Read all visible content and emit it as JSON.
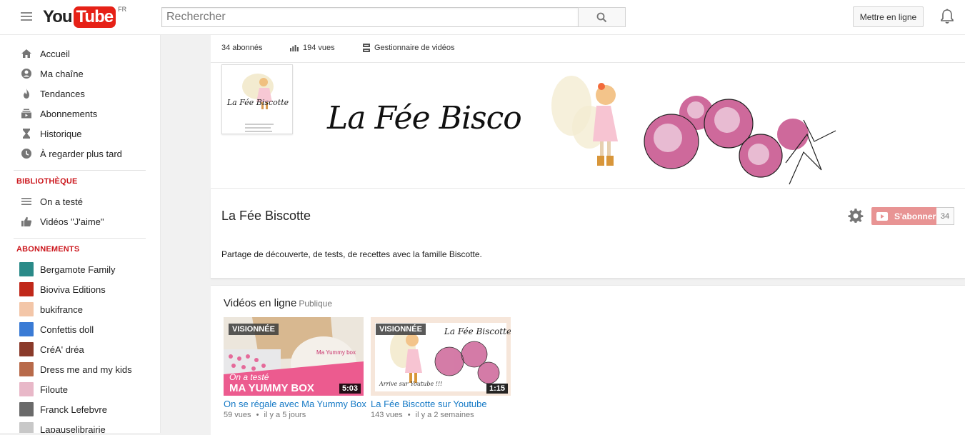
{
  "header": {
    "logo_you": "You",
    "logo_tube": "Tube",
    "country": "FR",
    "search_placeholder": "Rechercher",
    "upload_label": "Mettre en ligne"
  },
  "sidebar": {
    "main_items": [
      {
        "label": "Accueil",
        "icon": "home-icon"
      },
      {
        "label": "Ma chaîne",
        "icon": "account-icon"
      },
      {
        "label": "Tendances",
        "icon": "flame-icon"
      },
      {
        "label": "Abonnements",
        "icon": "subscriptions-icon"
      },
      {
        "label": "Historique",
        "icon": "hourglass-icon"
      },
      {
        "label": "À regarder plus tard",
        "icon": "clock-icon"
      }
    ],
    "library_title": "BIBLIOTHÈQUE",
    "library_items": [
      {
        "label": "On a testé",
        "icon": "playlist-icon"
      },
      {
        "label": "Vidéos \"J'aime\"",
        "icon": "thumbs-up-icon"
      }
    ],
    "subs_title": "ABONNEMENTS",
    "subs_items": [
      {
        "label": "Bergamote Family",
        "color": "#2a8a88"
      },
      {
        "label": "Bioviva Editions",
        "color": "#c0281a"
      },
      {
        "label": "bukifrance",
        "color": "#f3c6a8"
      },
      {
        "label": "Confettis doll",
        "color": "#3a7bd5"
      },
      {
        "label": "CréA' dréa",
        "color": "#8a3a2a"
      },
      {
        "label": "Dress me and my kids",
        "color": "#b86a4a"
      },
      {
        "label": "Filoute",
        "color": "#e8b8c8"
      },
      {
        "label": "Franck Lefebvre",
        "color": "#6a6a6a"
      },
      {
        "label": "Lapauselibrairie",
        "color": "#c8c8c8"
      }
    ]
  },
  "stats": {
    "subscribers": "34 abonnés",
    "views": "194 vues",
    "manager": "Gestionnaire de vidéos"
  },
  "banner": {
    "title": "La Fée Biscotte",
    "avatar_text": "La Fée Biscotte"
  },
  "channel": {
    "name": "La Fée Biscotte",
    "description": "Partage de découverte, de tests, de recettes avec la famille Biscotte.",
    "subscribe_label": "S'abonner",
    "subscribe_count": "34"
  },
  "videos_section": {
    "title": "Vidéos en ligne",
    "visibility": "Publique",
    "videos": [
      {
        "badge": "VISIONNÉE",
        "duration": "5:03",
        "title": "On se régale avec Ma Yummy Box",
        "views": "59 vues",
        "age": "il y a 5 jours",
        "thumb_line1": "On a testé",
        "thumb_line2": "MA YUMMY BOX",
        "thumb_brand": "Ma Yummy box"
      },
      {
        "badge": "VISIONNÉE",
        "duration": "1:15",
        "title": "La Fée Biscotte sur Youtube",
        "views": "143 vues",
        "age": "il y a 2 semaines",
        "thumb_title": "La Fée Biscotte",
        "thumb_caption": "Arrive sur Youtube !!!"
      }
    ]
  },
  "colors": {
    "accent_red": "#cc181e",
    "link_blue": "#167ac6",
    "subscribe_pink": "#e89494"
  }
}
